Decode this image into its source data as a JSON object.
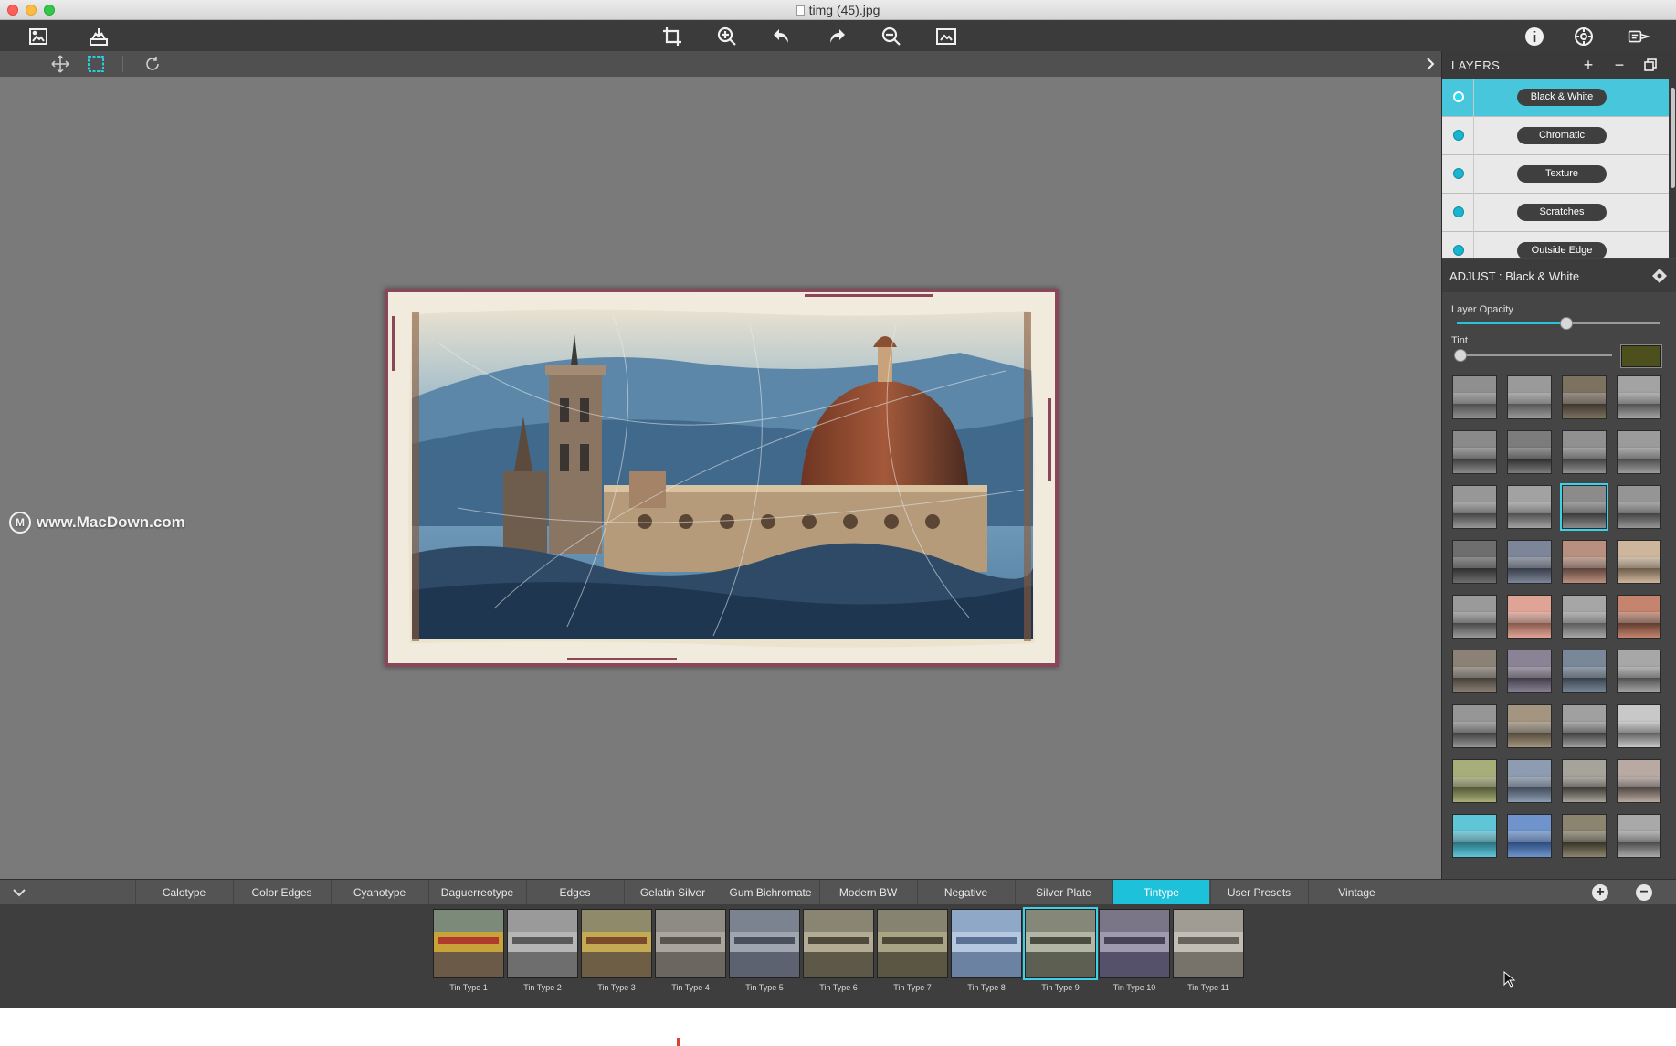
{
  "window": {
    "title": "timg (45).jpg"
  },
  "toolbar": {
    "left": [
      {
        "name": "open-image-icon"
      },
      {
        "name": "save-export-icon"
      }
    ],
    "center": [
      {
        "name": "crop-icon"
      },
      {
        "name": "zoom-in-icon"
      },
      {
        "name": "undo-icon"
      },
      {
        "name": "redo-icon"
      },
      {
        "name": "zoom-out-icon"
      },
      {
        "name": "fit-to-screen-icon"
      }
    ],
    "right": [
      {
        "name": "info-icon"
      },
      {
        "name": "settings-icon"
      },
      {
        "name": "share-icon"
      }
    ]
  },
  "canvas": {
    "watermark": "www.MacDown.com",
    "watermark_logo": "M"
  },
  "layers": {
    "title": "LAYERS",
    "add_label": "+",
    "remove_label": "−",
    "items": [
      {
        "label": "Black & White",
        "active": true
      },
      {
        "label": "Chromatic",
        "active": false
      },
      {
        "label": "Texture",
        "active": false
      },
      {
        "label": "Scratches",
        "active": false
      },
      {
        "label": "Outside Edge",
        "active": false
      }
    ]
  },
  "adjust": {
    "title": "ADJUST : Black & White",
    "opacity_label": "Layer Opacity",
    "opacity_value": 0.54,
    "tint_label": "Tint",
    "tint_value": 0.0,
    "tint_color": "#4d4f1d"
  },
  "presets": {
    "selected_index": 10,
    "colors": [
      [
        "#8f8f8f",
        "#4e4e4e"
      ],
      [
        "#9a9a9a",
        "#555555"
      ],
      [
        "#7d7160",
        "#3d362c"
      ],
      [
        "#a3a3a3",
        "#505050"
      ],
      [
        "#8a8a8a",
        "#3c3c3c"
      ],
      [
        "#7c7c7c",
        "#2c2c2c"
      ],
      [
        "#909090",
        "#3f3f3f"
      ],
      [
        "#9b9b9b",
        "#4a4a4a"
      ],
      [
        "#979797",
        "#444444"
      ],
      [
        "#a2a2a2",
        "#4f4f4f"
      ],
      [
        "#8b8b8b",
        "#3a3a3a"
      ],
      [
        "#959595",
        "#424242"
      ],
      [
        "#6e6e6e",
        "#2e2e2e"
      ],
      [
        "#7d8598",
        "#353b47"
      ],
      [
        "#b99080",
        "#5b4238"
      ],
      [
        "#cdb69c",
        "#6b5a47"
      ],
      [
        "#9a9a9a",
        "#474747"
      ],
      [
        "#e0a496",
        "#85584c"
      ],
      [
        "#a6a6a6",
        "#5a5a5a"
      ],
      [
        "#c4846e",
        "#5f3b2f"
      ],
      [
        "#8b8175",
        "#443e36"
      ],
      [
        "#8a8395",
        "#3f3a47"
      ],
      [
        "#788899",
        "#353f4b"
      ],
      [
        "#a7a7a7",
        "#4d4d4d"
      ],
      [
        "#969696",
        "#3e3e3e"
      ],
      [
        "#a3957f",
        "#51473a"
      ],
      [
        "#a0a0a0",
        "#3c3c3c"
      ],
      [
        "#c8c8c8",
        "#5d5d5d"
      ],
      [
        "#a8ae7a",
        "#525734"
      ],
      [
        "#8d9cb0",
        "#3f4a5a"
      ],
      [
        "#a6a39a",
        "#3b3933"
      ],
      [
        "#b8a9a2",
        "#4f4540"
      ],
      [
        "#5fc6d8",
        "#2a6f7d"
      ],
      [
        "#6f94cc",
        "#2a4b7c"
      ],
      [
        "#8b8570",
        "#363324"
      ],
      [
        "#a9a9a9",
        "#4b4b4b"
      ]
    ]
  },
  "categories": {
    "active": "Tintype",
    "tabs": [
      {
        "label": "Calotype"
      },
      {
        "label": "Color Edges"
      },
      {
        "label": "Cyanotype"
      },
      {
        "label": "Daguerreotype"
      },
      {
        "label": "Edges"
      },
      {
        "label": "Gelatin Silver"
      },
      {
        "label": "Gum Bichromate"
      },
      {
        "label": "Modern BW"
      },
      {
        "label": "Negative"
      },
      {
        "label": "Silver Plate"
      },
      {
        "label": "Tintype"
      },
      {
        "label": "User Presets"
      },
      {
        "label": "Vintage"
      }
    ],
    "add_label": "+",
    "remove_label": "−"
  },
  "filmstrip": {
    "selected_index": 8,
    "items": [
      {
        "label": "Tin Type 1",
        "sky": "#7c8a7a",
        "train": "#c7a33a",
        "track": "#6c5a48",
        "band": "#b23a2c"
      },
      {
        "label": "Tin Type 2",
        "sky": "#9a9a9a",
        "train": "#b6b6b6",
        "track": "#6e6e6e",
        "band": "#5a5a5a"
      },
      {
        "label": "Tin Type 3",
        "sky": "#8f8a6a",
        "train": "#c4aa52",
        "track": "#6e5e45",
        "band": "#7a4a2a"
      },
      {
        "label": "Tin Type 4",
        "sky": "#8e8a84",
        "train": "#aaa59d",
        "track": "#6b665f",
        "band": "#58544e"
      },
      {
        "label": "Tin Type 5",
        "sky": "#7b8290",
        "train": "#a0a6b0",
        "track": "#5c6270",
        "band": "#4a505c"
      },
      {
        "label": "Tin Type 6",
        "sky": "#8a8572",
        "train": "#b3ab94",
        "track": "#5e5848",
        "band": "#4f4a3c"
      },
      {
        "label": "Tin Type 7",
        "sky": "#868370",
        "train": "#aaa486",
        "track": "#5b5643",
        "band": "#4c4736"
      },
      {
        "label": "Tin Type 8",
        "sky": "#8fa8c8",
        "train": "#b5c8e0",
        "track": "#6c82a3",
        "band": "#5a7094"
      },
      {
        "label": "Tin Type 9",
        "sky": "#858878",
        "train": "#b2b6a4",
        "track": "#5c5f52",
        "band": "#4a4d40"
      },
      {
        "label": "Tin Type 10",
        "sky": "#7a7688",
        "train": "#9f9aae",
        "track": "#55516a",
        "band": "#484458"
      },
      {
        "label": "Tin Type 11",
        "sky": "#a09c94",
        "train": "#c2beb5",
        "track": "#77736b",
        "band": "#67635c"
      }
    ]
  }
}
